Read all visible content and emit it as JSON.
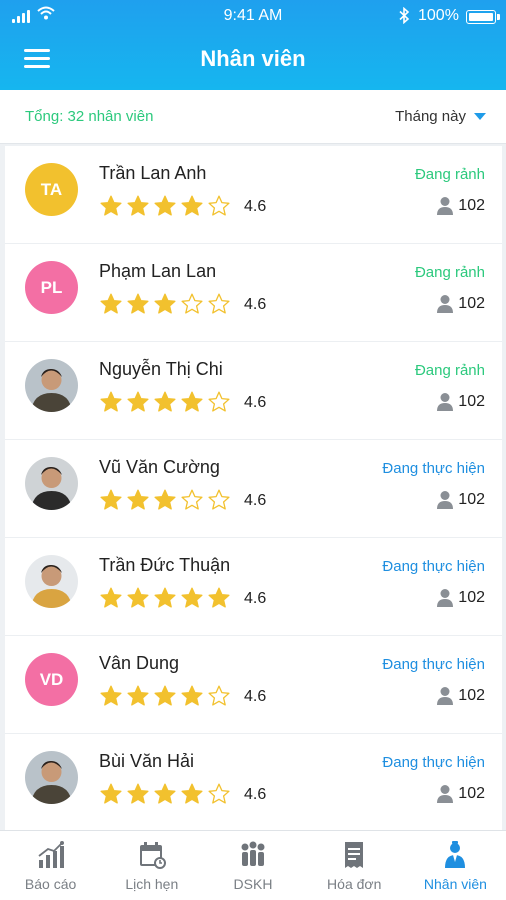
{
  "status_bar": {
    "time": "9:41 AM",
    "battery": "100%"
  },
  "header": {
    "title": "Nhân viên"
  },
  "summary": {
    "total": "Tổng: 32 nhân viên",
    "period": "Tháng này"
  },
  "colors": {
    "accent": "#1f9be8",
    "free": "#2cc97d",
    "busy": "#1f8fe0",
    "star": "#f2c12e",
    "avatar_yellow": "#f2c12e",
    "avatar_pink": "#f36fa4"
  },
  "employees": [
    {
      "initials": "TA",
      "avatar_color": "#f2c12e",
      "name": "Trần Lan Anh",
      "stars": 4,
      "rating": "4.6",
      "status": "Đang rảnh",
      "status_kind": "free",
      "count": "102"
    },
    {
      "initials": "PL",
      "avatar_color": "#f36fa4",
      "name": "Phạm Lan Lan",
      "stars": 3,
      "rating": "4.6",
      "status": "Đang rảnh",
      "status_kind": "free",
      "count": "102"
    },
    {
      "initials": "",
      "avatar_color": "photo",
      "name": "Nguyễn Thị Chi",
      "stars": 4,
      "rating": "4.6",
      "status": "Đang rảnh",
      "status_kind": "free",
      "count": "102"
    },
    {
      "initials": "",
      "avatar_color": "photo",
      "name": "Vũ Văn Cường",
      "stars": 3,
      "rating": "4.6",
      "status": "Đang thực hiện",
      "status_kind": "busy",
      "count": "102"
    },
    {
      "initials": "",
      "avatar_color": "photo",
      "name": "Trần Đức Thuận",
      "stars": 5,
      "rating": "4.6",
      "status": "Đang thực hiện",
      "status_kind": "busy",
      "count": "102"
    },
    {
      "initials": "VD",
      "avatar_color": "#f36fa4",
      "name": "Vân Dung",
      "stars": 4,
      "rating": "4.6",
      "status": "Đang thực hiện",
      "status_kind": "busy",
      "count": "102"
    },
    {
      "initials": "",
      "avatar_color": "photo",
      "name": "Bùi Văn Hải",
      "stars": 4,
      "rating": "4.6",
      "status": "Đang thực hiện",
      "status_kind": "busy",
      "count": "102"
    }
  ],
  "tabs": [
    {
      "label": "Báo cáo",
      "icon": "chart-icon",
      "active": false
    },
    {
      "label": "Lịch hẹn",
      "icon": "calendar-icon",
      "active": false
    },
    {
      "label": "DSKH",
      "icon": "customers-icon",
      "active": false
    },
    {
      "label": "Hóa đơn",
      "icon": "invoice-icon",
      "active": false
    },
    {
      "label": "Nhân viên",
      "icon": "staff-icon",
      "active": true
    }
  ]
}
